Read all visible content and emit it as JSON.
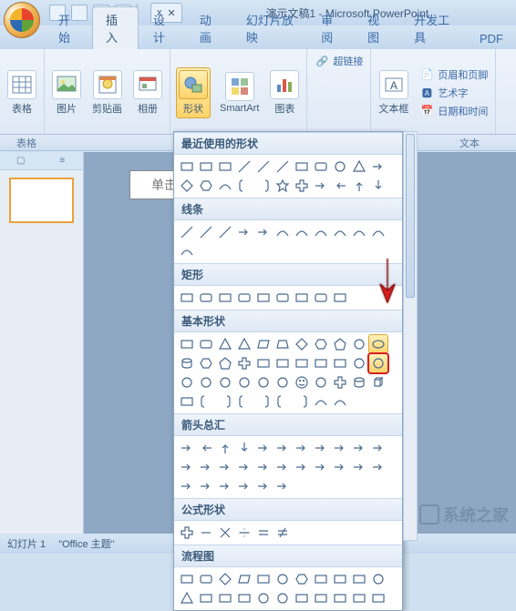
{
  "title": "演示文稿1 - Microsoft PowerPoint",
  "doc_tab": {
    "label": "x",
    "close": "✕"
  },
  "tabs": [
    "开始",
    "插入",
    "设计",
    "动画",
    "幻灯片放映",
    "审阅",
    "视图",
    "开发工具",
    "PDF"
  ],
  "active_tab": 1,
  "ribbon": {
    "tables": {
      "label": "表格",
      "btn": "表格"
    },
    "images": {
      "pic": "图片",
      "clip": "剪贴画",
      "album": "相册"
    },
    "illus": {
      "shapes": "形状",
      "smartart": "SmartArt",
      "chart": "图表"
    },
    "links": {
      "hyperlink": "超链接"
    },
    "text": {
      "box": "文本框",
      "header": "页眉和页脚",
      "wordart": "艺术字",
      "date": "日期和时间"
    },
    "group_tables": "表格",
    "group_text": "文本"
  },
  "shapes_dd": {
    "recent": "最近使用的形状",
    "lines": "线条",
    "rects": "矩形",
    "basic": "基本形状",
    "arrows": "箭头总汇",
    "equation": "公式形状",
    "flowchart": "流程图"
  },
  "chart_data": null,
  "slide_placeholder": "单击此",
  "status": {
    "slide": "幻灯片 1",
    "theme": "\"Office 主题\""
  },
  "watermark": "系统之家"
}
